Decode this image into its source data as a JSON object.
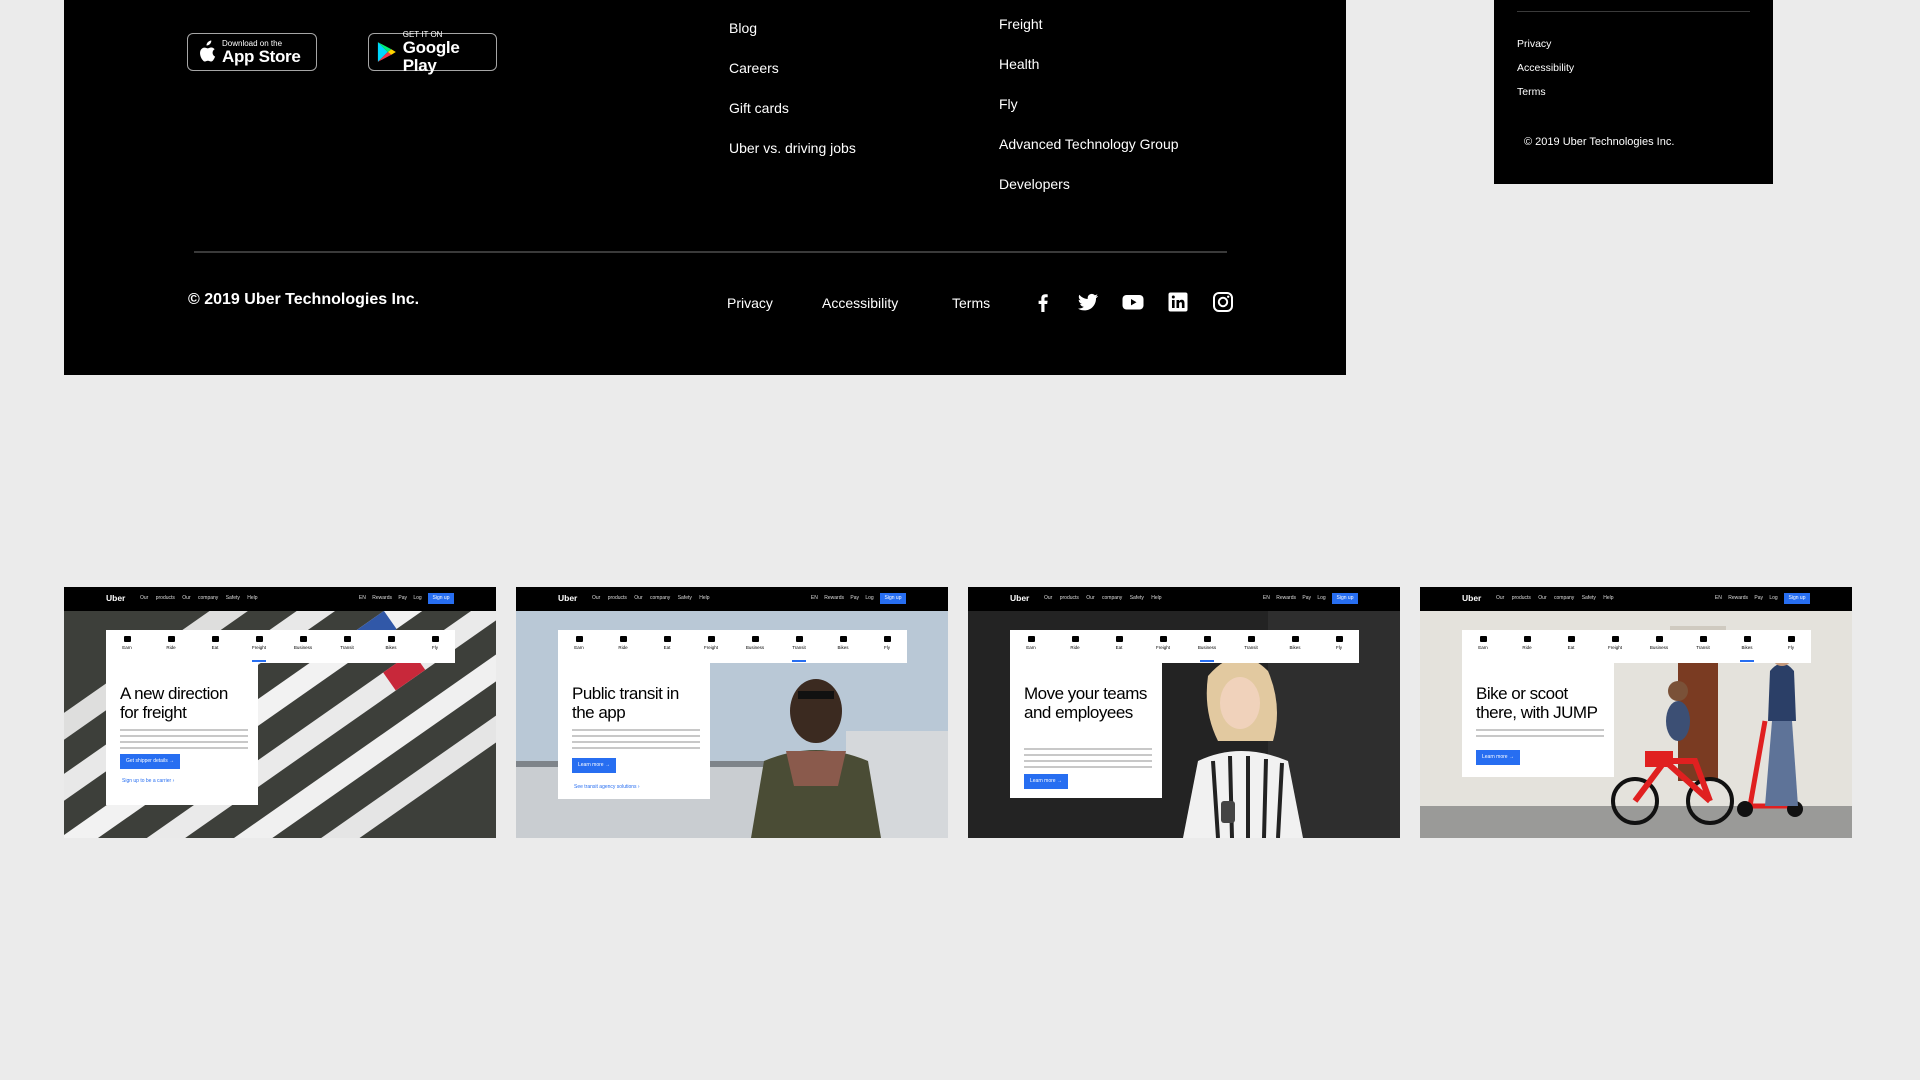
{
  "footer": {
    "app_store": {
      "small": "Download on the",
      "big": "App Store"
    },
    "google_play": {
      "small": "GET IT ON",
      "big": "Google Play"
    },
    "company_links": [
      "Blog",
      "Careers",
      "Gift cards",
      "Uber vs. driving jobs"
    ],
    "product_links": [
      "Freight",
      "Health",
      "Fly",
      "Advanced Technology Group",
      "Developers"
    ],
    "copyright": "© 2019 Uber Technologies Inc.",
    "legal_links": [
      "Privacy",
      "Accessibility",
      "Terms"
    ],
    "social_icons": [
      "facebook-icon",
      "twitter-icon",
      "youtube-icon",
      "linkedin-icon",
      "instagram-icon"
    ]
  },
  "mini_footer": {
    "legal_links": [
      "Privacy",
      "Accessibility",
      "Terms"
    ],
    "copyright": "© 2019 Uber Technologies Inc."
  },
  "thumb_common": {
    "logo": "Uber",
    "nav": "Our products Our company Safety Help",
    "nav_right": "EN Rewards Pay Log in",
    "signup": "Sign up",
    "tabs": [
      "Earn",
      "Ride",
      "Eat",
      "Freight",
      "Business",
      "Transit",
      "Bikes",
      "Fly"
    ]
  },
  "thumbs": [
    {
      "title": "A new direction for freight",
      "button": "Get shipper details →",
      "link": "Sign up to be a carrier ›"
    },
    {
      "title": "Public transit in the app",
      "button": "Learn more →",
      "link": "See transit agency solutions ›"
    },
    {
      "title": "Move your teams and employees",
      "button": "Learn more →",
      "link": ""
    },
    {
      "title": "Bike or scoot there, with JUMP",
      "button": "Learn more →",
      "link": ""
    }
  ],
  "colors": {
    "accent": "#276ef1",
    "footer_bg": "#000000",
    "page_bg": "#ebebeb"
  }
}
